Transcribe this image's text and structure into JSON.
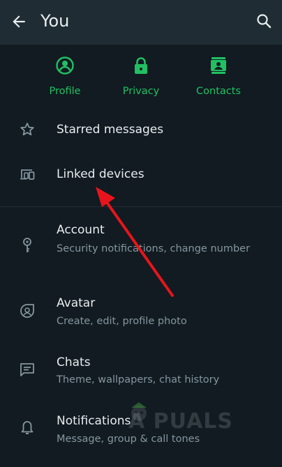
{
  "header": {
    "title": "You"
  },
  "quick_actions": [
    {
      "label": "Profile",
      "icon": "profile-icon"
    },
    {
      "label": "Privacy",
      "icon": "lock-icon"
    },
    {
      "label": "Contacts",
      "icon": "contacts-icon"
    }
  ],
  "menu": {
    "starred": {
      "title": "Starred messages",
      "icon": "star-icon"
    },
    "linked": {
      "title": "Linked devices",
      "icon": "linked-devices-icon"
    },
    "account": {
      "title": "Account",
      "subtitle": "Security notifications, change number",
      "icon": "key-icon"
    },
    "avatar": {
      "title": "Avatar",
      "subtitle": "Create, edit, profile photo",
      "icon": "avatar-icon"
    },
    "chats": {
      "title": "Chats",
      "subtitle": "Theme, wallpapers, chat history",
      "icon": "chat-icon"
    },
    "notifications": {
      "title": "Notifications",
      "subtitle": "Message, group & call tones",
      "icon": "bell-icon"
    }
  },
  "watermark": "A PUALS",
  "colors": {
    "background": "#111b21",
    "appbar": "#1f2c33",
    "accent": "#21c063",
    "secondary_text": "#8696a0",
    "annotation_arrow": "#e8141c"
  }
}
